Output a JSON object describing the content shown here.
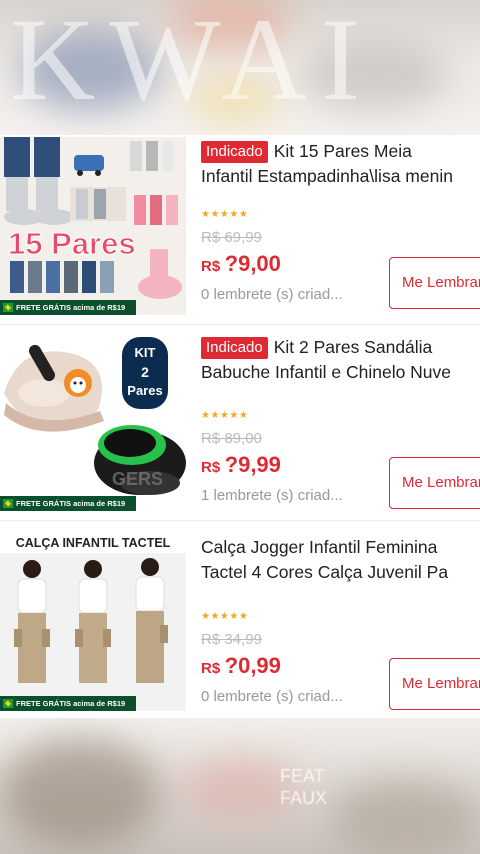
{
  "overlay": {
    "top_brand": "KWAI",
    "bottom_text_1": "FEAT",
    "bottom_text_2": "FAUX"
  },
  "products": [
    {
      "badge": "Indicado",
      "title_line1": "Kit 15 Pares Meia",
      "title_line2": "Infantil Estampadinha\\lisa menin",
      "image_label": "15 Pares",
      "shipping_label": "FRETE GRÁTIS acima de R$19",
      "rating": "★★★★★",
      "old_price": "R$ 69,99",
      "currency": "R$",
      "price": "?9,00",
      "reminders": "0 lembrete (s) criad...",
      "button": "Me Lembrar"
    },
    {
      "badge": "Indicado",
      "title_line1": "Kit 2 Pares Sandália",
      "title_line2": "Babuche Infantil e Chinelo Nuve",
      "image_label_1": "KIT",
      "image_label_2": "2",
      "image_label_3": "Pares",
      "shipping_label": "FRETE GRÁTIS acima de R$19",
      "rating": "★★★★★",
      "old_price": "R$ 89,00",
      "currency": "R$",
      "price": "?9,99",
      "reminders": "1 lembrete (s) criad...",
      "button": "Me Lembrar"
    },
    {
      "title_line1": "Calça Jogger Infantil Feminina",
      "title_line2": "Tactel 4 Cores Calça Juvenil Pa",
      "image_label": "CALÇA INFANTIL TACTEL",
      "shipping_label": "FRETE GRÁTIS acima de R$19",
      "rating": "★★★★★",
      "old_price": "R$ 34,99",
      "currency": "R$",
      "price": "?0,99",
      "reminders": "0 lembrete (s) criad...",
      "button": "Me Lembrar"
    }
  ],
  "colors": {
    "accent_red": "#e02a33",
    "star_orange": "#f5a623",
    "muted_gray": "#999999"
  }
}
